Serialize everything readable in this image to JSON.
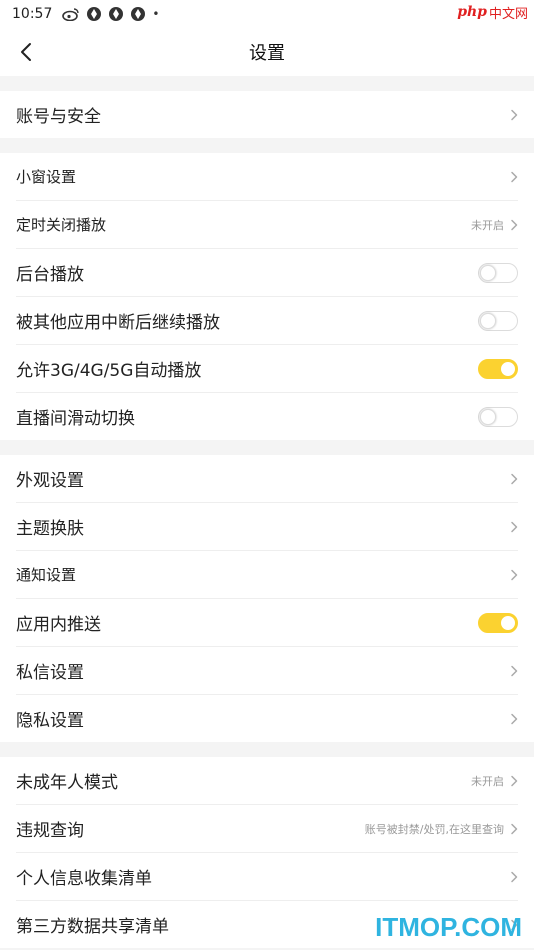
{
  "status_bar": {
    "time": "10:57",
    "dot": "•"
  },
  "watermark": {
    "php": "php",
    "cn": "中文网",
    "bottom": "ITMOP.COM"
  },
  "nav": {
    "title": "设置"
  },
  "groups": [
    {
      "rows": [
        {
          "label": "账号与安全",
          "small": false,
          "type": "link"
        }
      ]
    },
    {
      "rows": [
        {
          "label": "小窗设置",
          "small": true,
          "type": "link"
        },
        {
          "label": "定时关闭播放",
          "small": true,
          "type": "link",
          "hint": "未开启"
        },
        {
          "label": "后台播放",
          "small": false,
          "type": "toggle",
          "on": false
        },
        {
          "label": "被其他应用中断后继续播放",
          "small": false,
          "type": "toggle",
          "on": false
        },
        {
          "label": "允许3G/4G/5G自动播放",
          "small": false,
          "type": "toggle",
          "on": true
        },
        {
          "label": "直播间滑动切换",
          "small": false,
          "type": "toggle",
          "on": false
        }
      ]
    },
    {
      "rows": [
        {
          "label": "外观设置",
          "small": false,
          "type": "link"
        },
        {
          "label": "主题换肤",
          "small": false,
          "type": "link"
        },
        {
          "label": "通知设置",
          "small": true,
          "type": "link"
        },
        {
          "label": "应用内推送",
          "small": false,
          "type": "toggle",
          "on": true
        },
        {
          "label": "私信设置",
          "small": false,
          "type": "link"
        },
        {
          "label": "隐私设置",
          "small": false,
          "type": "link"
        }
      ]
    },
    {
      "rows": [
        {
          "label": "未成年人模式",
          "small": false,
          "type": "link",
          "hint": "未开启"
        },
        {
          "label": "违规查询",
          "small": false,
          "type": "link",
          "hint": "账号被封禁/处罚,在这里查询"
        },
        {
          "label": "个人信息收集清单",
          "small": false,
          "type": "link"
        },
        {
          "label": "第三方数据共享清单",
          "small": false,
          "type": "link"
        }
      ]
    }
  ],
  "colors": {
    "accent": "#fbd230",
    "hint": "#999999",
    "background": "#f4f4f4"
  }
}
